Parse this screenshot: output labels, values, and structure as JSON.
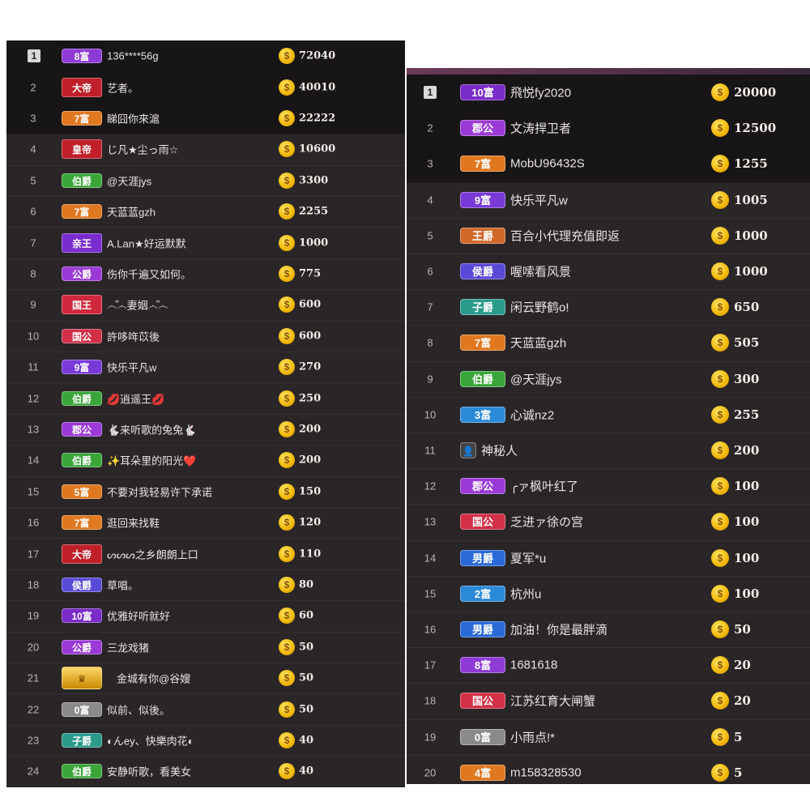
{
  "left_list": [
    {
      "rank": "1",
      "badge": "8富",
      "badge_color": "#8e3bd6",
      "name": "136****56g",
      "score": "72040"
    },
    {
      "rank": "2",
      "badge": "大帝",
      "badge_color": "#c0202a",
      "name": "艺者。",
      "score": "40010"
    },
    {
      "rank": "3",
      "badge": "7富",
      "badge_color": "#e07820",
      "name": "睇囧你來滬",
      "score": "22222"
    },
    {
      "rank": "4",
      "badge": "皇帝",
      "badge_color": "#c0202a",
      "name": "じ凡★尘っ雨☆",
      "score": "10600"
    },
    {
      "rank": "5",
      "badge": "伯爵",
      "badge_color": "#3aa63a",
      "name": "@天涯jys",
      "score": "3300"
    },
    {
      "rank": "6",
      "badge": "7富",
      "badge_color": "#e07820",
      "name": "天蓝蓝gzh",
      "score": "2255"
    },
    {
      "rank": "7",
      "badge": "亲王",
      "badge_color": "#7b2ccf",
      "name": "A.Lan★好运默默",
      "score": "1000"
    },
    {
      "rank": "8",
      "badge": "公爵",
      "badge_color": "#9b3ad6",
      "name": "伤你千遍又如何。",
      "score": "775"
    },
    {
      "rank": "9",
      "badge": "国王",
      "badge_color": "#d0283c",
      "name": "෴ⷨ෴妻姻෴ⷨ෴",
      "score": "600"
    },
    {
      "rank": "10",
      "badge": "国公",
      "badge_color": "#d23048",
      "name": "許哆哖苡後",
      "score": "600"
    },
    {
      "rank": "11",
      "badge": "9富",
      "badge_color": "#7a3ad8",
      "name": "快乐平凡w",
      "score": "270"
    },
    {
      "rank": "12",
      "badge": "伯爵",
      "badge_color": "#3aa63a",
      "name": "💋逍遥王💋",
      "score": "250"
    },
    {
      "rank": "13",
      "badge": "郡公",
      "badge_color": "#9b3ad6",
      "name": "🐇来听歌的兔兔🐇",
      "score": "200"
    },
    {
      "rank": "14",
      "badge": "伯爵",
      "badge_color": "#3aa63a",
      "name": "✨耳朵里的阳光❤️",
      "score": "200"
    },
    {
      "rank": "15",
      "badge": "5富",
      "badge_color": "#e07820",
      "name": "不要对我轻易许下承诺",
      "score": "150"
    },
    {
      "rank": "16",
      "badge": "7富",
      "badge_color": "#e07820",
      "name": "逛回来找鞋",
      "score": "120"
    },
    {
      "rank": "17",
      "badge": "大帝",
      "badge_color": "#c0202a",
      "name": "ᔕᔕᔕ之乡朗朗上口",
      "score": "110"
    },
    {
      "rank": "18",
      "badge": "侯爵",
      "badge_color": "#5a4ad8",
      "name": "草唱。",
      "score": "80"
    },
    {
      "rank": "19",
      "badge": "10富",
      "badge_color": "#7a2cc8",
      "name": "优雅好听就好",
      "score": "60"
    },
    {
      "rank": "20",
      "badge": "公爵",
      "badge_color": "#9b3ad6",
      "name": "三龙戏猪",
      "score": "50"
    },
    {
      "rank": "21",
      "badge": "",
      "badge_color": "#d89a1a",
      "name": "金城有你@谷嫂",
      "score": "50"
    },
    {
      "rank": "22",
      "badge": "0富",
      "badge_color": "#8a8a8a",
      "name": "似前、似後。",
      "score": "50"
    },
    {
      "rank": "23",
      "badge": "子爵",
      "badge_color": "#2a9a8a",
      "name": "◐んey、快樂肉花◐",
      "score": "40"
    },
    {
      "rank": "24",
      "badge": "伯爵",
      "badge_color": "#3aa63a",
      "name": "安静听歌，看美女",
      "score": "40"
    }
  ],
  "right_list": [
    {
      "rank": "1",
      "badge": "10富",
      "badge_color": "#7a2cc8",
      "name": "飛悦fy2020",
      "score": "20000"
    },
    {
      "rank": "2",
      "badge": "郡公",
      "badge_color": "#9b3ad6",
      "name": "文涛捍卫者",
      "score": "12500"
    },
    {
      "rank": "3",
      "badge": "7富",
      "badge_color": "#e07820",
      "name": "MobU96432S",
      "score": "1255"
    },
    {
      "rank": "4",
      "badge": "9富",
      "badge_color": "#7a3ad8",
      "name": "快乐平凡w",
      "score": "1005"
    },
    {
      "rank": "5",
      "badge": "王爵",
      "badge_color": "#d2692a",
      "name": "百合小代理充值即返",
      "score": "1000"
    },
    {
      "rank": "6",
      "badge": "侯爵",
      "badge_color": "#5a4ad8",
      "name": "喔嗦看风景",
      "score": "1000"
    },
    {
      "rank": "7",
      "badge": "子爵",
      "badge_color": "#2a9a8a",
      "name": "闲云野鹤o!",
      "score": "650"
    },
    {
      "rank": "8",
      "badge": "7富",
      "badge_color": "#e07820",
      "name": "天蓝蓝gzh",
      "score": "505"
    },
    {
      "rank": "9",
      "badge": "伯爵",
      "badge_color": "#3aa63a",
      "name": "@天涯jys",
      "score": "300"
    },
    {
      "rank": "10",
      "badge": "3富",
      "badge_color": "#2a8ad8",
      "name": "心诚nz2",
      "score": "255"
    },
    {
      "rank": "11",
      "badge": "",
      "badge_color": "#555555",
      "name": "神秘人",
      "score": "200"
    },
    {
      "rank": "12",
      "badge": "郡公",
      "badge_color": "#9b3ad6",
      "name": "╭ァ枫叶红了",
      "score": "100"
    },
    {
      "rank": "13",
      "badge": "国公",
      "badge_color": "#d23048",
      "name": "乏进ァ徐の宫",
      "score": "100"
    },
    {
      "rank": "14",
      "badge": "男爵",
      "badge_color": "#2a6ad8",
      "name": "夏军*u",
      "score": "100"
    },
    {
      "rank": "15",
      "badge": "2富",
      "badge_color": "#2a8ad8",
      "name": "杭州u",
      "score": "100"
    },
    {
      "rank": "16",
      "badge": "男爵",
      "badge_color": "#2a6ad8",
      "name": "加油！你是最胖滴",
      "score": "50"
    },
    {
      "rank": "17",
      "badge": "8富",
      "badge_color": "#8e3bd6",
      "name": "1681618",
      "score": "20"
    },
    {
      "rank": "18",
      "badge": "国公",
      "badge_color": "#d23048",
      "name": "江苏红育大闸蟹",
      "score": "20"
    },
    {
      "rank": "19",
      "badge": "0富",
      "badge_color": "#8a8a8a",
      "name": "小雨点!*",
      "score": "5"
    },
    {
      "rank": "20",
      "badge": "4富",
      "badge_color": "#e07820",
      "name": "m158328530",
      "score": "5"
    }
  ]
}
